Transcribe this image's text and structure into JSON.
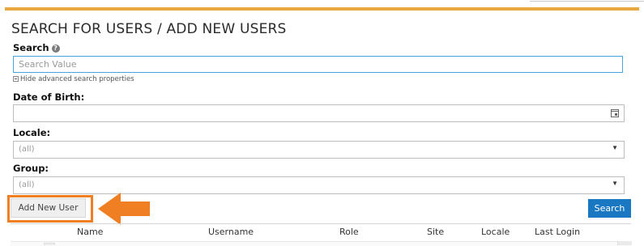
{
  "page": {
    "title": "SEARCH FOR USERS / ADD NEW USERS",
    "accent_color": "#e8a840"
  },
  "search": {
    "label": "Search",
    "help_icon": "question-circle-icon",
    "placeholder": "Search Value",
    "value": "",
    "advanced_toggle_label": "Hide advanced search properties"
  },
  "dob": {
    "label": "Date of Birth:",
    "value": "",
    "icon": "calendar-icon"
  },
  "locale": {
    "label": "Locale:",
    "selected": "(all)"
  },
  "group": {
    "label": "Group:",
    "selected": "(all)"
  },
  "actions": {
    "add_new_user_label": "Add New User",
    "search_label": "Search",
    "highlight_color": "#f07f24",
    "search_button_color": "#1a78c2"
  },
  "table": {
    "columns": [
      "Name",
      "Username",
      "Role",
      "Site",
      "Locale",
      "Last Login"
    ]
  }
}
